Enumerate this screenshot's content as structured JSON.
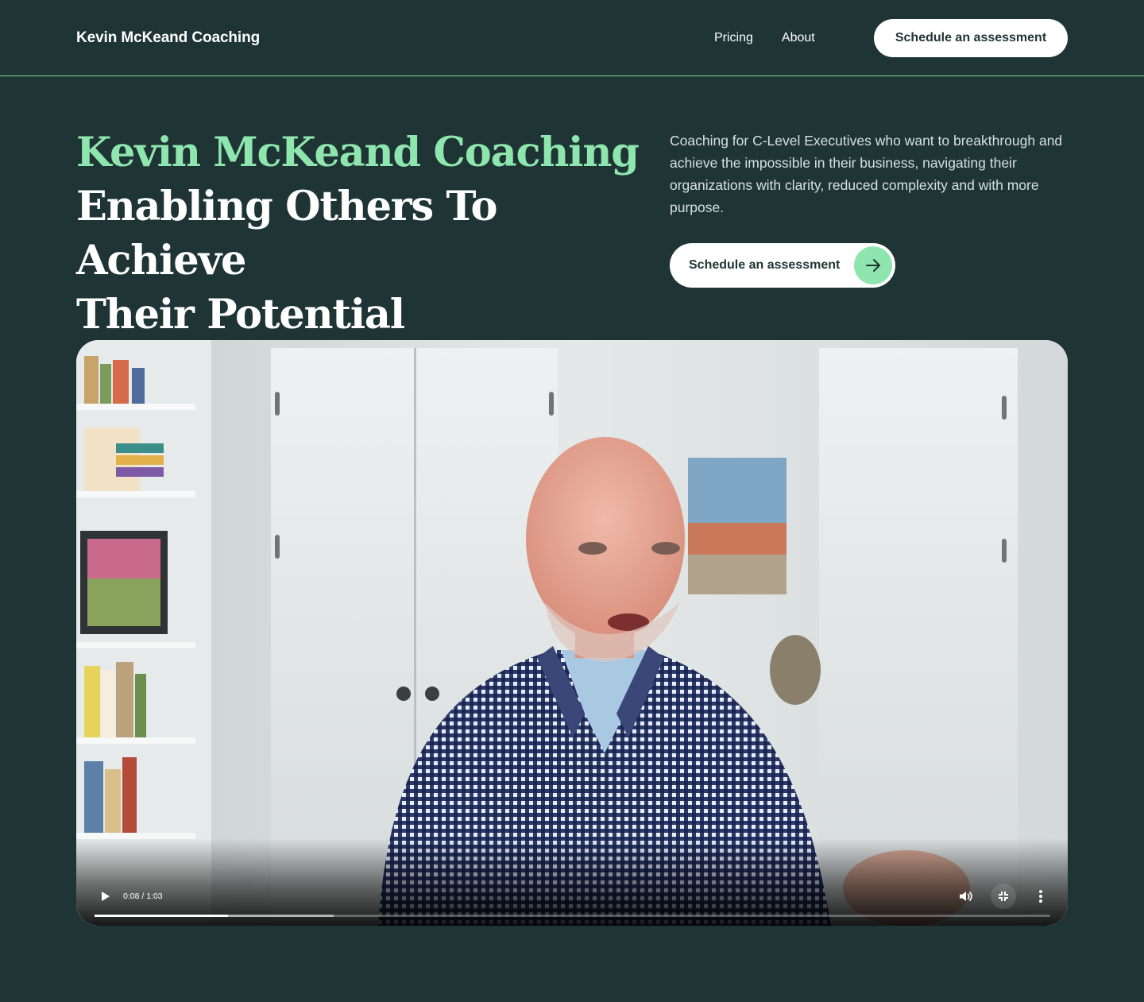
{
  "header": {
    "brand": "Kevin McKeand Coaching",
    "nav": [
      {
        "label": "Pricing"
      },
      {
        "label": "About"
      }
    ],
    "cta_label": "Schedule an assessment"
  },
  "hero": {
    "title_accent": "Kevin McKeand Coaching",
    "title_line_1": "Enabling Others To Achieve",
    "title_line_2": "Their Potential",
    "description": "Coaching for C-Level Executives who want to breakthrough and achieve the impossible in their business, navigating their organizations with clarity, reduced complexity and with more purpose.",
    "cta_label": "Schedule an assessment",
    "cta_icon": "arrow-right-icon"
  },
  "video": {
    "time_display": "0:08 / 1:03",
    "played_fraction": 0.14,
    "buffered_fraction": 0.25,
    "controls": [
      "play-icon",
      "volume-icon",
      "exit-fullscreen-icon",
      "more-options-icon"
    ]
  },
  "colors": {
    "background": "#1e3435",
    "accent": "#8ee5ad",
    "text": "#ffffff",
    "muted_text": "#d6e1df"
  }
}
